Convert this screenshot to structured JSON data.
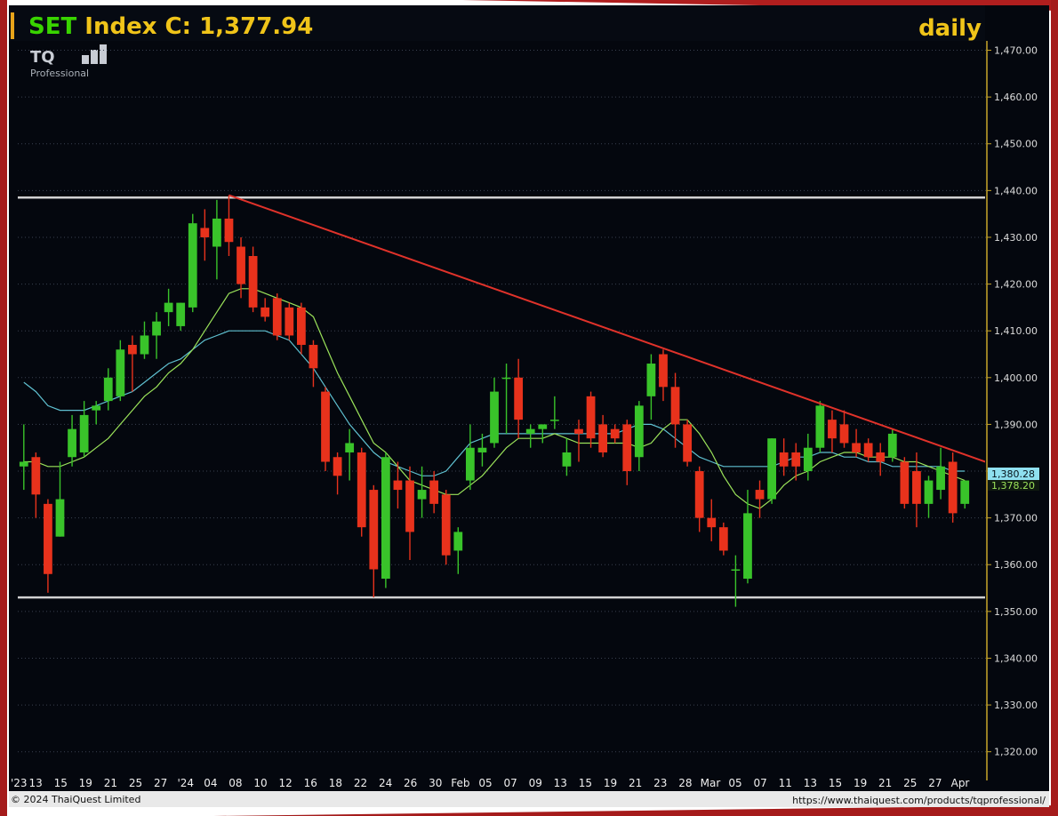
{
  "header": {
    "title": "SET Index C: 1,377.94",
    "title_color": "#f0c419",
    "title_accent_color": "#39d400",
    "period": "daily",
    "period_color": "#39d400"
  },
  "logo": {
    "mark": "TQ",
    "sub": "Professional"
  },
  "footer": {
    "copyright": "© 2024  ThaiQuest Limited",
    "url": "https://www.thaiquest.com/products/tqprofessional/"
  },
  "price_tags": {
    "ma_long": "1,380.28",
    "ma_short": "1,378.20"
  },
  "colors": {
    "background": "#04070e",
    "up": "#39c32a",
    "down": "#e8321c",
    "ma_short": "#9be35a",
    "ma_long": "#5fc0d0",
    "trendline": "#e0322a",
    "range_lines": "#d2d2d2",
    "grid": "#3a4150"
  },
  "chart_data": {
    "type": "candlestick",
    "title": "SET Index C: 1,377.94",
    "period": "daily",
    "ylim": [
      1315,
      1472
    ],
    "y_ticks": [
      1320,
      1330,
      1340,
      1350,
      1360,
      1370,
      1380,
      1390,
      1400,
      1410,
      1420,
      1430,
      1440,
      1450,
      1460,
      1470
    ],
    "y_tick_labels": [
      "1,320.00",
      "1,330.00",
      "1,340.00",
      "1,350.00",
      "1,360.00",
      "1,370.00",
      "1,380.00",
      "1,390.00",
      "1,400.00",
      "1,410.00",
      "1,420.00",
      "1,430.00",
      "1,440.00",
      "1,450.00",
      "1,460.00",
      "1,470.00"
    ],
    "x_tick_labels": [
      "'23",
      "13",
      "15",
      "19",
      "21",
      "25",
      "27",
      "'24",
      "04",
      "08",
      "10",
      "12",
      "16",
      "18",
      "22",
      "24",
      "26",
      "30",
      "Feb",
      "05",
      "07",
      "09",
      "13",
      "15",
      "19",
      "21",
      "23",
      "28",
      "Mar",
      "05",
      "07",
      "11",
      "13",
      "15",
      "19",
      "21",
      "25",
      "27",
      "Apr"
    ],
    "grid": true,
    "legend": "none",
    "candles": [
      {
        "o": 1381,
        "h": 1390,
        "l": 1376,
        "c": 1382
      },
      {
        "o": 1383,
        "h": 1384,
        "l": 1370,
        "c": 1375
      },
      {
        "o": 1373,
        "h": 1374,
        "l": 1354,
        "c": 1358
      },
      {
        "o": 1366,
        "h": 1382,
        "l": 1366,
        "c": 1374
      },
      {
        "o": 1383,
        "h": 1392,
        "l": 1381,
        "c": 1389
      },
      {
        "o": 1384,
        "h": 1395,
        "l": 1383,
        "c": 1392
      },
      {
        "o": 1393,
        "h": 1395,
        "l": 1390,
        "c": 1394
      },
      {
        "o": 1395,
        "h": 1402,
        "l": 1393,
        "c": 1400
      },
      {
        "o": 1396,
        "h": 1408,
        "l": 1395,
        "c": 1406
      },
      {
        "o": 1407,
        "h": 1409,
        "l": 1397,
        "c": 1405
      },
      {
        "o": 1405,
        "h": 1412,
        "l": 1404,
        "c": 1409
      },
      {
        "o": 1409,
        "h": 1414,
        "l": 1404,
        "c": 1412
      },
      {
        "o": 1414,
        "h": 1419,
        "l": 1411,
        "c": 1416
      },
      {
        "o": 1411,
        "h": 1416,
        "l": 1410,
        "c": 1416
      },
      {
        "o": 1415,
        "h": 1435,
        "l": 1414,
        "c": 1433
      },
      {
        "o": 1432,
        "h": 1436,
        "l": 1425,
        "c": 1430
      },
      {
        "o": 1428,
        "h": 1438,
        "l": 1421,
        "c": 1434
      },
      {
        "o": 1434,
        "h": 1439,
        "l": 1426,
        "c": 1429
      },
      {
        "o": 1428,
        "h": 1430,
        "l": 1417,
        "c": 1420
      },
      {
        "o": 1426,
        "h": 1428,
        "l": 1414,
        "c": 1415
      },
      {
        "o": 1415,
        "h": 1417,
        "l": 1412,
        "c": 1413
      },
      {
        "o": 1417,
        "h": 1418,
        "l": 1408,
        "c": 1409
      },
      {
        "o": 1415,
        "h": 1416,
        "l": 1408,
        "c": 1409
      },
      {
        "o": 1415,
        "h": 1416,
        "l": 1405,
        "c": 1407
      },
      {
        "o": 1407,
        "h": 1408,
        "l": 1398,
        "c": 1402
      },
      {
        "o": 1397,
        "h": 1398,
        "l": 1380,
        "c": 1382
      },
      {
        "o": 1383,
        "h": 1384,
        "l": 1375,
        "c": 1379
      },
      {
        "o": 1384,
        "h": 1389,
        "l": 1378,
        "c": 1386
      },
      {
        "o": 1384,
        "h": 1385,
        "l": 1366,
        "c": 1368
      },
      {
        "o": 1376,
        "h": 1377,
        "l": 1353,
        "c": 1359
      },
      {
        "o": 1357,
        "h": 1384,
        "l": 1355,
        "c": 1383
      },
      {
        "o": 1378,
        "h": 1382,
        "l": 1372,
        "c": 1376
      },
      {
        "o": 1378,
        "h": 1381,
        "l": 1361,
        "c": 1367
      },
      {
        "o": 1374,
        "h": 1381,
        "l": 1370,
        "c": 1376
      },
      {
        "o": 1378,
        "h": 1380,
        "l": 1371,
        "c": 1373
      },
      {
        "o": 1375,
        "h": 1376,
        "l": 1360,
        "c": 1362
      },
      {
        "o": 1363,
        "h": 1368,
        "l": 1358,
        "c": 1367
      },
      {
        "o": 1378,
        "h": 1390,
        "l": 1376,
        "c": 1385
      },
      {
        "o": 1384,
        "h": 1388,
        "l": 1381,
        "c": 1385
      },
      {
        "o": 1386,
        "h": 1400,
        "l": 1385,
        "c": 1397
      },
      {
        "o": 1400,
        "h": 1403,
        "l": 1388,
        "c": 1400
      },
      {
        "o": 1400,
        "h": 1404,
        "l": 1387,
        "c": 1391
      },
      {
        "o": 1388,
        "h": 1390,
        "l": 1385,
        "c": 1389
      },
      {
        "o": 1389,
        "h": 1390,
        "l": 1386,
        "c": 1390
      },
      {
        "o": 1391,
        "h": 1396,
        "l": 1389,
        "c": 1391
      },
      {
        "o": 1381,
        "h": 1387,
        "l": 1379,
        "c": 1384
      },
      {
        "o": 1389,
        "h": 1391,
        "l": 1382,
        "c": 1388
      },
      {
        "o": 1396,
        "h": 1397,
        "l": 1385,
        "c": 1387
      },
      {
        "o": 1390,
        "h": 1392,
        "l": 1383,
        "c": 1384
      },
      {
        "o": 1389,
        "h": 1390,
        "l": 1386,
        "c": 1387
      },
      {
        "o": 1390,
        "h": 1391,
        "l": 1377,
        "c": 1380
      },
      {
        "o": 1383,
        "h": 1395,
        "l": 1380,
        "c": 1394
      },
      {
        "o": 1396,
        "h": 1405,
        "l": 1391,
        "c": 1403
      },
      {
        "o": 1405,
        "h": 1406,
        "l": 1395,
        "c": 1398
      },
      {
        "o": 1398,
        "h": 1401,
        "l": 1385,
        "c": 1390
      },
      {
        "o": 1390,
        "h": 1391,
        "l": 1381,
        "c": 1382
      },
      {
        "o": 1380,
        "h": 1381,
        "l": 1367,
        "c": 1370
      },
      {
        "o": 1370,
        "h": 1374,
        "l": 1365,
        "c": 1368
      },
      {
        "o": 1368,
        "h": 1369,
        "l": 1362,
        "c": 1363
      },
      {
        "o": 1359,
        "h": 1362,
        "l": 1351,
        "c": 1359
      },
      {
        "o": 1357,
        "h": 1376,
        "l": 1356,
        "c": 1371
      },
      {
        "o": 1376,
        "h": 1378,
        "l": 1370,
        "c": 1374
      },
      {
        "o": 1374,
        "h": 1387,
        "l": 1373,
        "c": 1387
      },
      {
        "o": 1384,
        "h": 1387,
        "l": 1379,
        "c": 1381
      },
      {
        "o": 1384,
        "h": 1386,
        "l": 1378,
        "c": 1381
      },
      {
        "o": 1380,
        "h": 1388,
        "l": 1378,
        "c": 1385
      },
      {
        "o": 1385,
        "h": 1395,
        "l": 1384,
        "c": 1394
      },
      {
        "o": 1391,
        "h": 1393,
        "l": 1384,
        "c": 1387
      },
      {
        "o": 1390,
        "h": 1393,
        "l": 1385,
        "c": 1386
      },
      {
        "o": 1386,
        "h": 1389,
        "l": 1383,
        "c": 1384
      },
      {
        "o": 1386,
        "h": 1387,
        "l": 1382,
        "c": 1383
      },
      {
        "o": 1384,
        "h": 1386,
        "l": 1379,
        "c": 1382
      },
      {
        "o": 1383,
        "h": 1389,
        "l": 1382,
        "c": 1388
      },
      {
        "o": 1382,
        "h": 1383,
        "l": 1372,
        "c": 1373
      },
      {
        "o": 1380,
        "h": 1384,
        "l": 1368,
        "c": 1373
      },
      {
        "o": 1373,
        "h": 1379,
        "l": 1370,
        "c": 1378
      },
      {
        "o": 1376,
        "h": 1385,
        "l": 1374,
        "c": 1381
      },
      {
        "o": 1382,
        "h": 1384,
        "l": 1369,
        "c": 1371
      },
      {
        "o": 1373,
        "h": 1378,
        "l": 1372,
        "c": 1378
      }
    ],
    "ma_short": [
      1382,
      1382,
      1381,
      1381,
      1382,
      1383,
      1385,
      1387,
      1390,
      1393,
      1396,
      1398,
      1401,
      1403,
      1406,
      1410,
      1414,
      1418,
      1419,
      1419,
      1418,
      1417,
      1416,
      1415,
      1413,
      1407,
      1401,
      1396,
      1391,
      1386,
      1384,
      1381,
      1378,
      1377,
      1376,
      1375,
      1375,
      1377,
      1379,
      1382,
      1385,
      1387,
      1387,
      1387,
      1388,
      1387,
      1386,
      1386,
      1386,
      1386,
      1386,
      1385,
      1386,
      1389,
      1391,
      1391,
      1388,
      1384,
      1379,
      1375,
      1373,
      1372,
      1374,
      1377,
      1379,
      1380,
      1382,
      1383,
      1384,
      1384,
      1383,
      1383,
      1383,
      1382,
      1382,
      1381,
      1380,
      1379,
      1378
    ],
    "ma_long": [
      1399,
      1397,
      1394,
      1393,
      1393,
      1393,
      1394,
      1395,
      1396,
      1397,
      1399,
      1401,
      1403,
      1404,
      1406,
      1408,
      1409,
      1410,
      1410,
      1410,
      1410,
      1409,
      1408,
      1405,
      1402,
      1398,
      1394,
      1390,
      1387,
      1384,
      1382,
      1381,
      1380,
      1379,
      1379,
      1380,
      1383,
      1386,
      1387,
      1388,
      1388,
      1388,
      1388,
      1388,
      1388,
      1388,
      1388,
      1388,
      1388,
      1388,
      1389,
      1390,
      1390,
      1389,
      1387,
      1385,
      1383,
      1382,
      1381,
      1381,
      1381,
      1381,
      1381,
      1382,
      1383,
      1383,
      1384,
      1384,
      1383,
      1383,
      1382,
      1382,
      1381,
      1381,
      1381,
      1381,
      1381,
      1380,
      1380
    ],
    "horizontal_lines": [
      1438.5,
      1353
    ],
    "trendline": {
      "from_index": 17,
      "from_value": 1439,
      "to_index": 80,
      "to_value": 1381
    }
  }
}
